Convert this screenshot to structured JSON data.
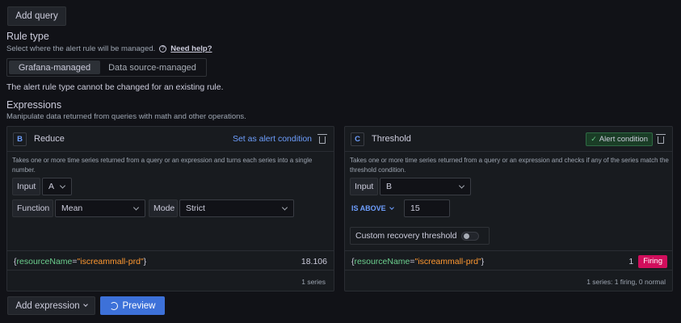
{
  "toolbar": {
    "add_query_label": "Add query"
  },
  "rule_type": {
    "title": "Rule type",
    "desc": "Select where the alert rule will be managed.",
    "help_link": "Need help?",
    "options": [
      "Grafana-managed",
      "Data source-managed"
    ],
    "selected": "Grafana-managed",
    "note": "The alert rule type cannot be changed for an existing rule."
  },
  "expressions": {
    "title": "Expressions",
    "desc": "Manipulate data returned from queries with math and other operations."
  },
  "reduce": {
    "ref": "B",
    "name": "Reduce",
    "set_alert_label": "Set as alert condition",
    "desc": "Takes one or more time series returned from a query or an expression and turns each series into a single number.",
    "input_label": "Input",
    "input_value": "A",
    "function_label": "Function",
    "function_value": "Mean",
    "mode_label": "Mode",
    "mode_value": "Strict",
    "result": {
      "brace_open": "{",
      "key": "resourceName",
      "eq": "=",
      "value": "\"iscreammall-prd\"",
      "brace_close": "}",
      "number": "18.106"
    },
    "footer": "1 series"
  },
  "threshold": {
    "ref": "C",
    "name": "Threshold",
    "alert_badge": "Alert condition",
    "desc": "Takes one or more time series returned from a query or an expression and checks if any of the series match the threshold condition.",
    "input_label": "Input",
    "input_value": "B",
    "condition": "IS ABOVE",
    "threshold_value": "15",
    "recovery_label": "Custom recovery threshold",
    "result": {
      "brace_open": "{",
      "key": "resourceName",
      "eq": "=",
      "value": "\"iscreammall-prd\"",
      "brace_close": "}",
      "number": "1",
      "state": "Firing"
    },
    "footer": "1 series: 1 firing, 0 normal"
  },
  "footer_buttons": {
    "add_expression": "Add expression",
    "preview": "Preview"
  },
  "colors": {
    "background": "#111217",
    "card": "#181b1f",
    "accent_blue": "#3d71d9",
    "link_blue": "#6e9fff",
    "firing": "#d10e5c",
    "alert_green": "#6ccf8e"
  },
  "icons": [
    "help-circle-icon",
    "trash-icon",
    "check-icon",
    "chevron-down-icon",
    "sync-icon",
    "toggle-switch"
  ]
}
